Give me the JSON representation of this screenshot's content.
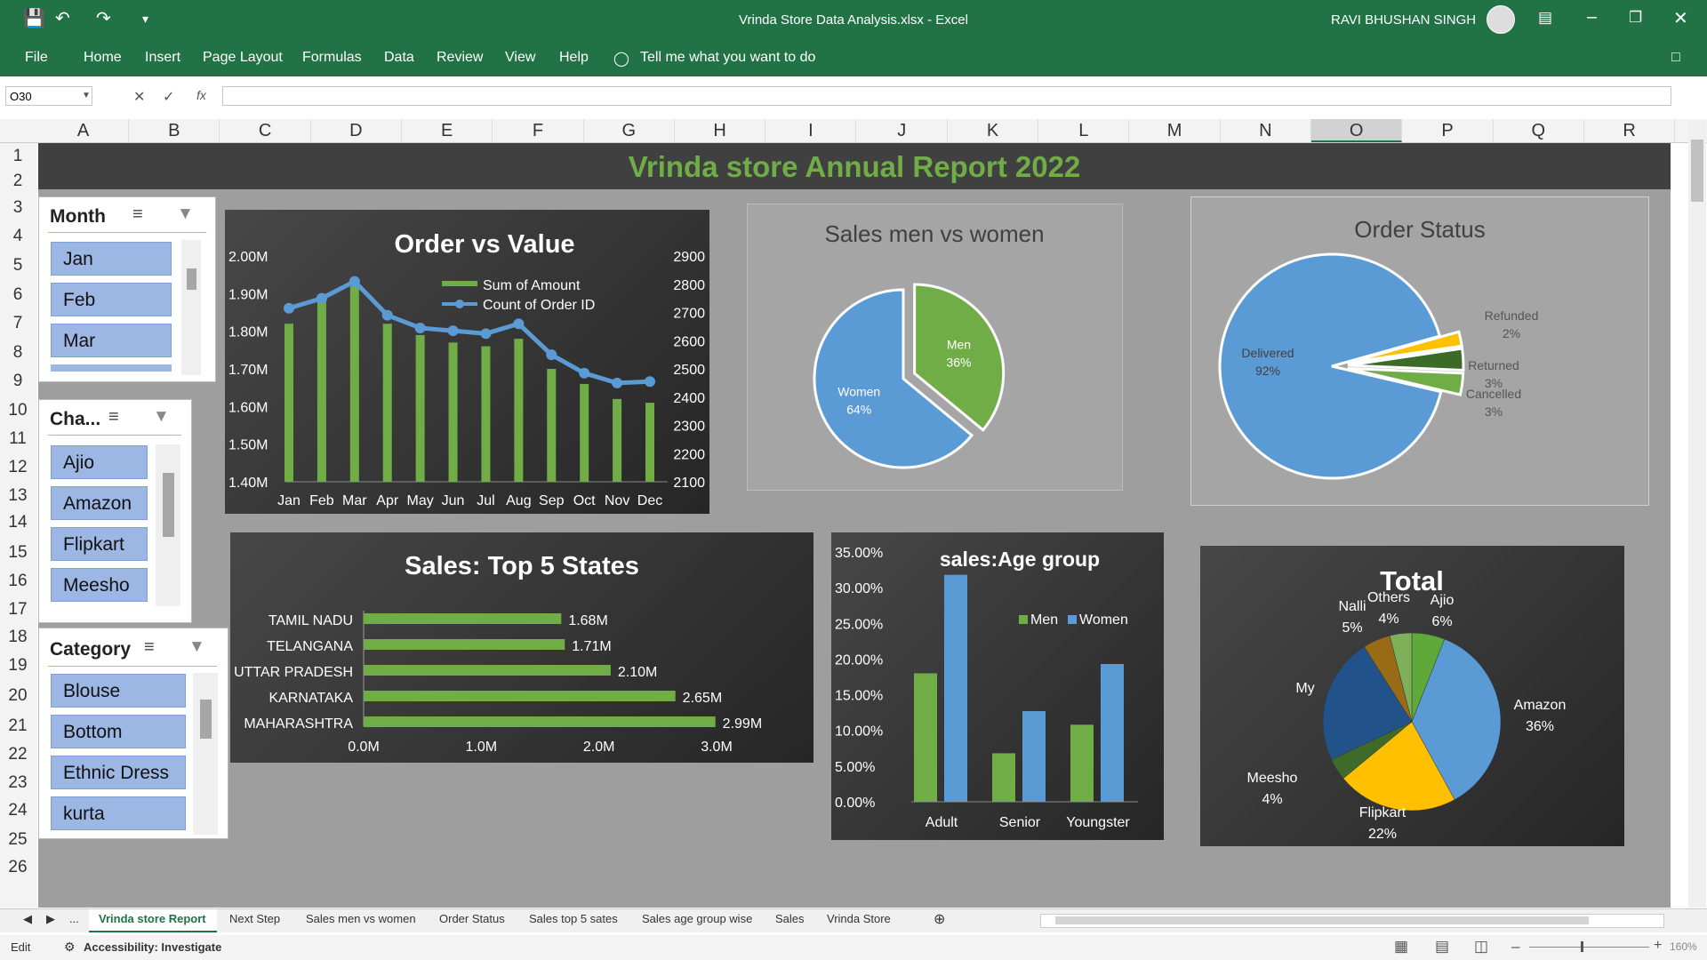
{
  "window": {
    "title": "Vrinda Store Data Analysis.xlsx  -  Excel",
    "user": "RAVI BHUSHAN SINGH"
  },
  "ribbon": {
    "tabs": [
      "File",
      "Home",
      "Insert",
      "Page Layout",
      "Formulas",
      "Data",
      "Review",
      "View",
      "Help"
    ],
    "tellme": "Tell me what you want to do"
  },
  "formula": {
    "namebox": "O30",
    "fx": "fx"
  },
  "columns": [
    "A",
    "B",
    "C",
    "D",
    "E",
    "F",
    "G",
    "H",
    "I",
    "J",
    "K",
    "L",
    "M",
    "N",
    "O",
    "P",
    "Q",
    "R"
  ],
  "rows": [
    "1",
    "2",
    "3",
    "4",
    "5",
    "6",
    "7",
    "8",
    "9",
    "10",
    "11",
    "12",
    "13",
    "14",
    "15",
    "16",
    "17",
    "18",
    "19",
    "20",
    "21",
    "22",
    "23",
    "24",
    "25",
    "26"
  ],
  "report_title": "Vrinda store Annual Report 2022",
  "slicers": {
    "month": {
      "title": "Month",
      "items": [
        "Jan",
        "Feb",
        "Mar"
      ]
    },
    "channel": {
      "title": "Cha...",
      "items": [
        "Ajio",
        "Amazon",
        "Flipkart",
        "Meesho"
      ]
    },
    "category": {
      "title": "Category",
      "items": [
        "Blouse",
        "Bottom",
        "Ethnic Dress",
        "kurta"
      ]
    }
  },
  "colors": {
    "green": "#70ad47",
    "blue": "#5b9bd5",
    "yellow": "#ffc000",
    "title_green": "#70ad47",
    "excel_green": "#217346"
  },
  "chart_data": [
    {
      "type": "bar",
      "title": "Order vs Value",
      "categories": [
        "Jan",
        "Feb",
        "Mar",
        "Apr",
        "May",
        "Jun",
        "Jul",
        "Aug",
        "Sep",
        "Oct",
        "Nov",
        "Dec"
      ],
      "series": [
        {
          "name": "Sum of Amount",
          "values": [
            1.82,
            1.88,
            1.92,
            1.82,
            1.79,
            1.77,
            1.76,
            1.78,
            1.7,
            1.66,
            1.62,
            1.61
          ]
        },
        {
          "name": "Count of Order ID",
          "values": [
            2715,
            2750,
            2810,
            2690,
            2645,
            2635,
            2625,
            2660,
            2550,
            2485,
            2450,
            2455
          ]
        }
      ],
      "y_left": {
        "ticks": [
          "2.00M",
          "1.90M",
          "1.80M",
          "1.70M",
          "1.60M",
          "1.50M",
          "1.40M"
        ],
        "range": [
          1.4,
          2.0
        ]
      },
      "y_right": {
        "ticks": [
          "2900",
          "2800",
          "2700",
          "2600",
          "2500",
          "2400",
          "2300",
          "2200",
          "2100"
        ],
        "range": [
          2100,
          2900
        ]
      }
    },
    {
      "type": "pie",
      "title": "Sales men vs women",
      "slices": [
        {
          "label": "Men",
          "pct_label": "36%",
          "value": 36
        },
        {
          "label": "Women",
          "pct_label": "64%",
          "value": 64
        }
      ]
    },
    {
      "type": "pie",
      "title": "Order Status",
      "slices": [
        {
          "label": "Delivered",
          "pct_label": "92%",
          "value": 92
        },
        {
          "label": "Refunded",
          "pct_label": "2%",
          "value": 2
        },
        {
          "label": "Returned",
          "pct_label": "3%",
          "value": 3
        },
        {
          "label": "Cancelled",
          "pct_label": "3%",
          "value": 3
        }
      ]
    },
    {
      "type": "bar",
      "title": "Sales: Top 5 States",
      "orientation": "horizontal",
      "categories": [
        "TAMIL NADU",
        "TELANGANA",
        "UTTAR PRADESH",
        "KARNATAKA",
        "MAHARASHTRA"
      ],
      "values": [
        1.68,
        1.71,
        2.1,
        2.65,
        2.99
      ],
      "value_labels": [
        "1.68M",
        "1.71M",
        "2.10M",
        "2.65M",
        "2.99M"
      ],
      "x_ticks": [
        "0.0M",
        "1.0M",
        "2.0M",
        "3.0M"
      ],
      "xlim": [
        0,
        3
      ]
    },
    {
      "type": "bar",
      "title": "sales:Age group",
      "categories": [
        "Adult",
        "Senior",
        "Youngster"
      ],
      "series": [
        {
          "name": "Men",
          "values": [
            18.0,
            6.8,
            10.8
          ]
        },
        {
          "name": "Women",
          "values": [
            31.8,
            12.7,
            19.3
          ]
        }
      ],
      "y_ticks": [
        "35.00%",
        "30.00%",
        "25.00%",
        "20.00%",
        "15.00%",
        "10.00%",
        "5.00%",
        "0.00%"
      ],
      "ylim": [
        0,
        35
      ]
    },
    {
      "type": "pie",
      "title": "Total",
      "slices": [
        {
          "label": "Ajio",
          "pct_label": "6%",
          "value": 6
        },
        {
          "label": "Amazon",
          "pct_label": "36%",
          "value": 36
        },
        {
          "label": "Flipkart",
          "pct_label": "22%",
          "value": 22
        },
        {
          "label": "Meesho",
          "pct_label": "4%",
          "value": 4
        },
        {
          "label": "My",
          "pct_label": "",
          "value": 23
        },
        {
          "label": "Nalli",
          "pct_label": "5%",
          "value": 5
        },
        {
          "label": "Others",
          "pct_label": "4%",
          "value": 4
        }
      ]
    }
  ],
  "sheet_tabs": [
    "...",
    "Vrinda store Report",
    "Next Step",
    "Sales men vs women",
    "Order Status",
    "Sales top 5 sates",
    "Sales age group wise",
    "Sales",
    "Vrinda Store"
  ],
  "status": {
    "mode": "Edit",
    "accessibility": "Accessibility: Investigate",
    "zoom": "160%"
  }
}
